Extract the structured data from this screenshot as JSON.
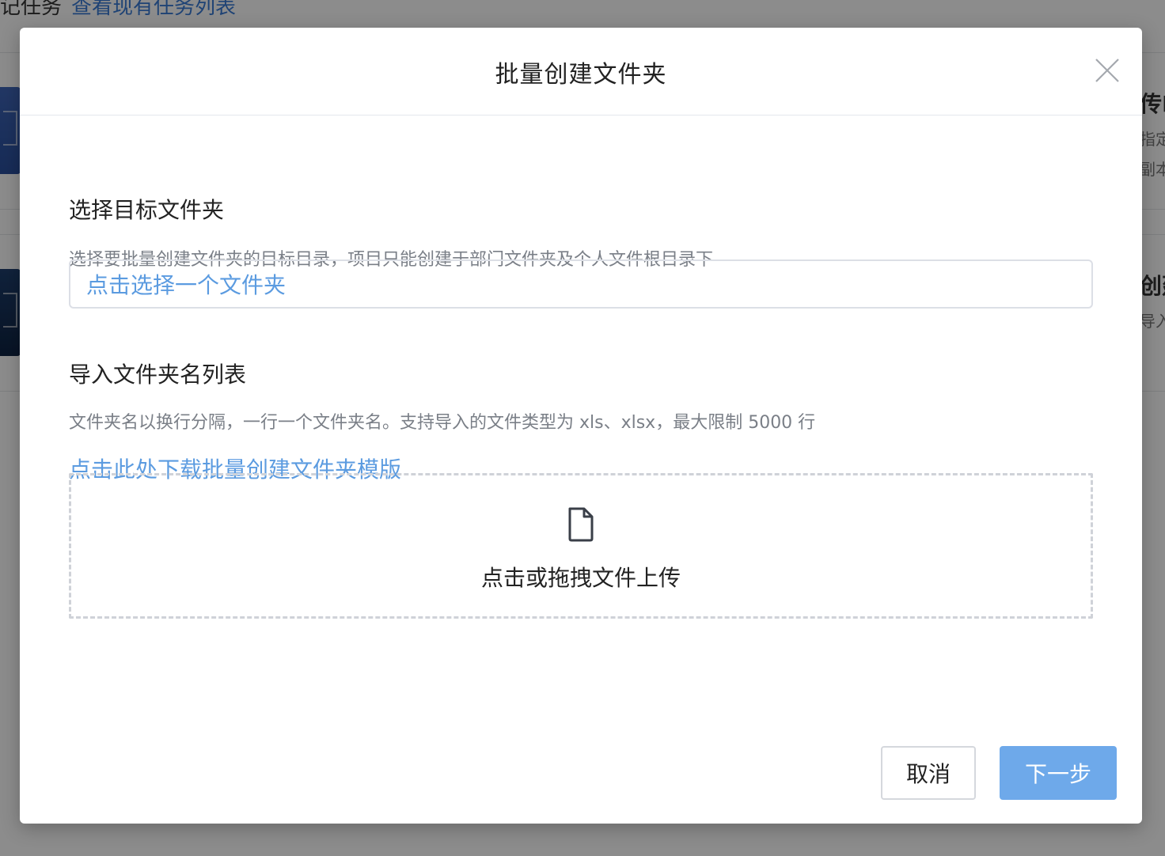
{
  "background": {
    "top_text": "记任务",
    "top_link": "查看现有任务列表",
    "side_title_1": "传F",
    "side_sub_1a": "指定",
    "side_sub_1b": "副本",
    "side_title_2": "创建",
    "side_sub_2": "导入"
  },
  "modal": {
    "title": "批量创建文件夹",
    "close_icon": "close-icon",
    "section1": {
      "title": "选择目标文件夹",
      "help": "选择要批量创建文件夹的目标目录，项目只能创建于部门文件夹及个人文件根目录下",
      "select_placeholder": "点击选择一个文件夹"
    },
    "section2": {
      "title": "导入文件夹名列表",
      "help": "文件夹名以换行分隔，一行一个文件夹名。支持导入的文件类型为 xls、xlsx，最大限制 5000 行",
      "template_link": "点击此处下载批量创建文件夹模版",
      "upload_icon": "file-icon",
      "upload_text": "点击或拖拽文件上传"
    },
    "footer": {
      "cancel_label": "取消",
      "next_label": "下一步"
    }
  },
  "colors": {
    "link": "#5b9be0",
    "primary_button": "#6ea9ea",
    "overlay": "rgba(0,0,0,0.45)"
  }
}
